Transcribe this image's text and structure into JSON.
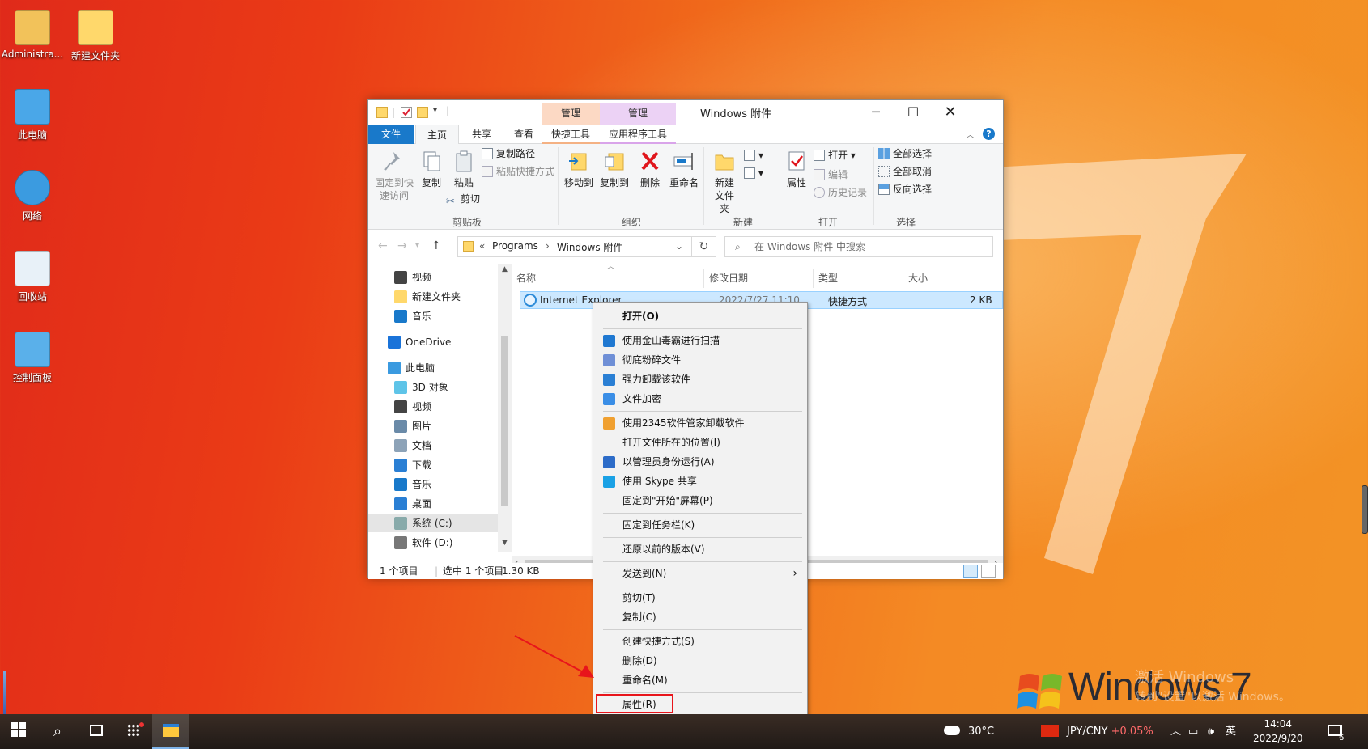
{
  "desktop": {
    "icons": [
      {
        "label": "Administra...",
        "icon": "user-folder-icon"
      },
      {
        "label": "新建文件夹",
        "icon": "folder-icon"
      },
      {
        "label": "此电脑",
        "icon": "computer-icon"
      },
      {
        "label": "网络",
        "icon": "network-icon"
      },
      {
        "label": "回收站",
        "icon": "recycle-bin-icon"
      },
      {
        "label": "控制面板",
        "icon": "control-panel-icon"
      }
    ],
    "wallpaper_brand": "Windows 7",
    "watermark_line1": "激活 Windows",
    "watermark_line2": "转到\"设置\"以激活 Windows。"
  },
  "explorer": {
    "title": "Windows 附件",
    "context_tabs": [
      {
        "header": "管理",
        "tab": "快捷工具",
        "color": "#fcd9c4"
      },
      {
        "header": "管理",
        "tab": "应用程序工具",
        "color": "#ecd2f5"
      }
    ],
    "tabs": [
      "文件",
      "主页",
      "共享",
      "查看"
    ],
    "ribbon": {
      "clipboard": {
        "pin": "固定到快速访问",
        "copy": "复制",
        "paste": "粘贴",
        "copy_path": "复制路径",
        "paste_shortcut": "粘贴快捷方式",
        "cut": "剪切",
        "group": "剪贴板"
      },
      "organize": {
        "move_to": "移动到",
        "copy_to": "复制到",
        "delete": "删除",
        "rename": "重命名",
        "group": "组织"
      },
      "new": {
        "new_folder": "新建文件夹",
        "group": "新建"
      },
      "open": {
        "properties": "属性",
        "open": "打开",
        "edit": "编辑",
        "history": "历史记录",
        "group": "打开"
      },
      "select": {
        "select_all": "全部选择",
        "select_none": "全部取消",
        "invert": "反向选择",
        "group": "选择"
      }
    },
    "address": {
      "prefix": "«",
      "path": [
        "Programs",
        "Windows 附件"
      ]
    },
    "search_placeholder": "在 Windows 附件 中搜索",
    "nav": [
      {
        "label": "视频",
        "icon": "video-icon",
        "indent": 1
      },
      {
        "label": "新建文件夹",
        "icon": "folder-icon",
        "indent": 1
      },
      {
        "label": "音乐",
        "icon": "music-icon",
        "indent": 1
      },
      {
        "label": "OneDrive",
        "icon": "onedrive-icon",
        "indent": 0
      },
      {
        "label": "此电脑",
        "icon": "computer-icon",
        "indent": 0
      },
      {
        "label": "3D 对象",
        "icon": "3d-objects-icon",
        "indent": 1
      },
      {
        "label": "视频",
        "icon": "video-icon",
        "indent": 1
      },
      {
        "label": "图片",
        "icon": "pictures-icon",
        "indent": 1
      },
      {
        "label": "文档",
        "icon": "documents-icon",
        "indent": 1
      },
      {
        "label": "下载",
        "icon": "downloads-icon",
        "indent": 1
      },
      {
        "label": "音乐",
        "icon": "music-icon",
        "indent": 1
      },
      {
        "label": "桌面",
        "icon": "desktop-icon",
        "indent": 1
      },
      {
        "label": "系统 (C:)",
        "icon": "drive-c-icon",
        "indent": 1,
        "selected": true
      },
      {
        "label": "软件 (D:)",
        "icon": "drive-d-icon",
        "indent": 1
      }
    ],
    "columns": [
      "名称",
      "修改日期",
      "类型",
      "大小"
    ],
    "files": [
      {
        "name": "Internet Explorer",
        "date": "2022/7/27 11:10",
        "type": "快捷方式",
        "size": "2 KB"
      }
    ],
    "status": {
      "count": "1 个项目",
      "selected": "选中 1 个项目",
      "size": "1.30 KB"
    }
  },
  "context_menu": {
    "items": [
      {
        "label": "打开(O)",
        "bold": true
      },
      {
        "sep": true
      },
      {
        "label": "使用金山毒霸进行扫描",
        "icon": "#1f78d1"
      },
      {
        "label": "彻底粉碎文件",
        "icon": "#6f8fd6"
      },
      {
        "label": "强力卸载该软件",
        "icon": "#2a7fd4"
      },
      {
        "label": "文件加密",
        "icon": "#3a8ee6"
      },
      {
        "sep": true
      },
      {
        "label": "使用2345软件管家卸载软件",
        "icon": "#f0a030"
      },
      {
        "label": "打开文件所在的位置(I)"
      },
      {
        "label": "以管理员身份运行(A)",
        "icon": "#2d6cc8"
      },
      {
        "label": "使用 Skype 共享",
        "icon": "#1aa1e5"
      },
      {
        "label": "固定到\"开始\"屏幕(P)"
      },
      {
        "sep": true
      },
      {
        "label": "固定到任务栏(K)"
      },
      {
        "sep": true
      },
      {
        "label": "还原以前的版本(V)"
      },
      {
        "sep": true
      },
      {
        "label": "发送到(N)",
        "submenu": true
      },
      {
        "sep": true
      },
      {
        "label": "剪切(T)"
      },
      {
        "label": "复制(C)"
      },
      {
        "sep": true
      },
      {
        "label": "创建快捷方式(S)"
      },
      {
        "label": "删除(D)"
      },
      {
        "label": "重命名(M)"
      },
      {
        "sep": true
      },
      {
        "label": "属性(R)",
        "highlighted": true
      }
    ]
  },
  "taskbar": {
    "weather": "30°C",
    "currency": "JPY/CNY",
    "change": "+0.05%",
    "ime": "英",
    "time": "14:04",
    "date": "2022/9/20",
    "notifications": "6"
  }
}
